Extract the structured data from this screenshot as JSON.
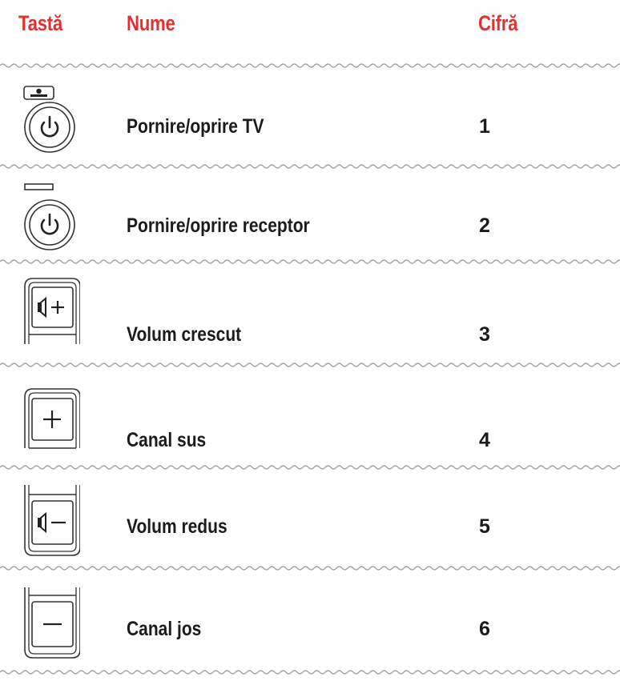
{
  "header": {
    "col_key": "Tastă",
    "col_name": "Nume",
    "col_digit": "Cifră"
  },
  "colors": {
    "accent": "#e5302f",
    "text": "#1b1b1b",
    "line": "#9a9a9a"
  },
  "rows": [
    {
      "name": "Pornire/oprire TV",
      "digit": "1",
      "icon": "tv-power-icon"
    },
    {
      "name": "Pornire/oprire receptor",
      "digit": "2",
      "icon": "receiver-power-icon"
    },
    {
      "name": "Volum crescut",
      "digit": "3",
      "icon": "volume-up-icon"
    },
    {
      "name": "Canal sus",
      "digit": "4",
      "icon": "channel-up-icon"
    },
    {
      "name": "Volum redus",
      "digit": "5",
      "icon": "volume-down-icon"
    },
    {
      "name": "Canal jos",
      "digit": "6",
      "icon": "channel-down-icon"
    }
  ]
}
